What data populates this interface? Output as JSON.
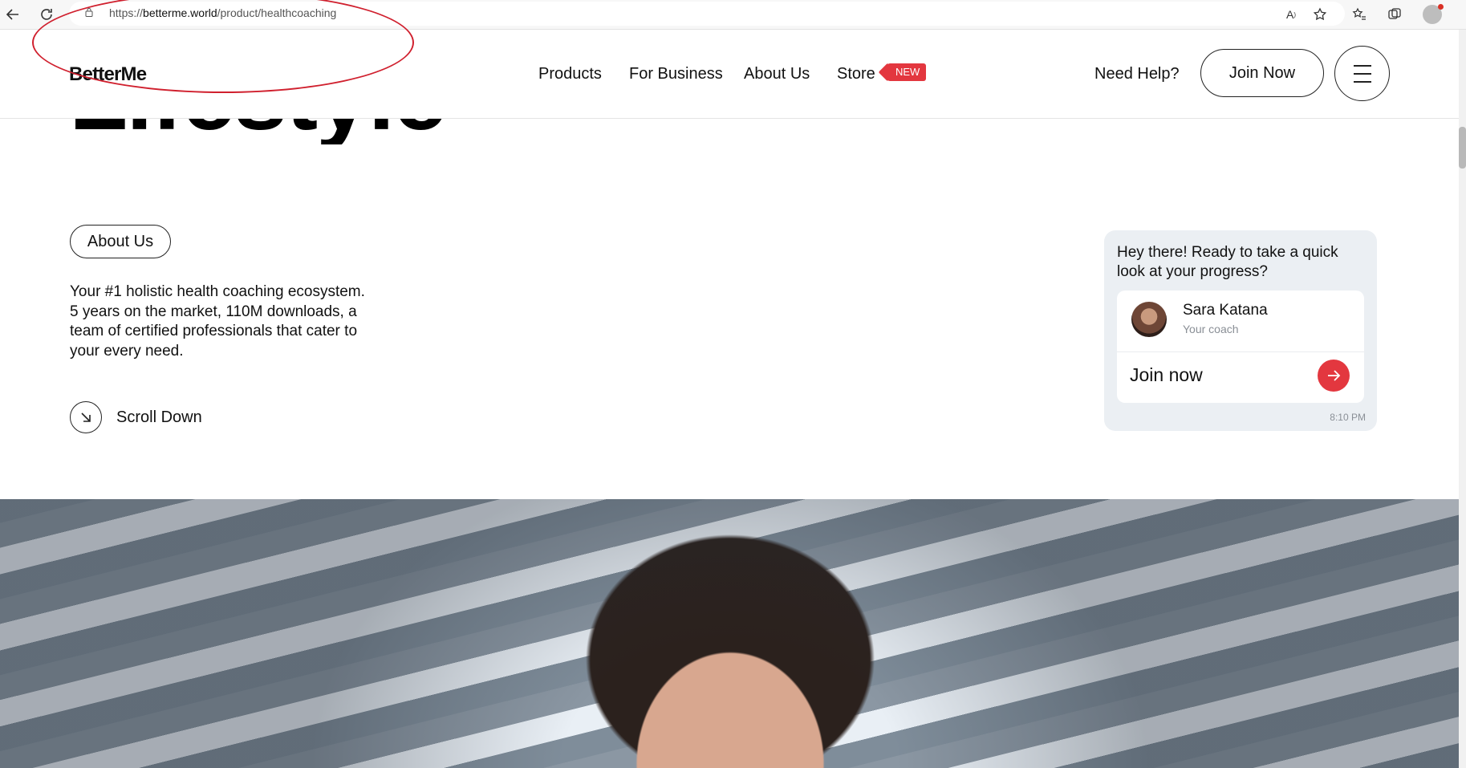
{
  "browser": {
    "url_prefix": "https://",
    "url_host": "betterme.world",
    "url_path": "/product/healthcoaching"
  },
  "header": {
    "logo": "BetterMe",
    "nav": [
      {
        "label": "Products"
      },
      {
        "label": "For Business"
      },
      {
        "label": "About Us"
      },
      {
        "label": "Store"
      }
    ],
    "store_badge": "NEW",
    "help": "Need Help?",
    "join": "Join Now"
  },
  "hero": {
    "title": "Lifestyle",
    "about_pill": "About Us",
    "description_lines": [
      "Your #1 holistic health coaching ecosystem.",
      "5 years on the market, 110M downloads, a",
      "team of certified professionals that cater to",
      "your every need."
    ],
    "scroll_label": "Scroll Down"
  },
  "chat": {
    "message": "Hey there! Ready to take a quick look at your progress?",
    "coach_name": "Sara Katana",
    "coach_role": "Your coach",
    "cta": "Join now",
    "time": "8:10 PM"
  },
  "colors": {
    "accent_red": "#e3373f",
    "annotation_red": "#d0202e",
    "chat_bg": "#ebeff3"
  },
  "icons": [
    "back-icon",
    "refresh-icon",
    "lock-icon",
    "read-aloud-icon",
    "favorite-icon",
    "favorites-bar-icon",
    "collections-icon",
    "profile-icon",
    "menu-icon",
    "arrow-down-right-icon",
    "arrow-right-icon"
  ]
}
